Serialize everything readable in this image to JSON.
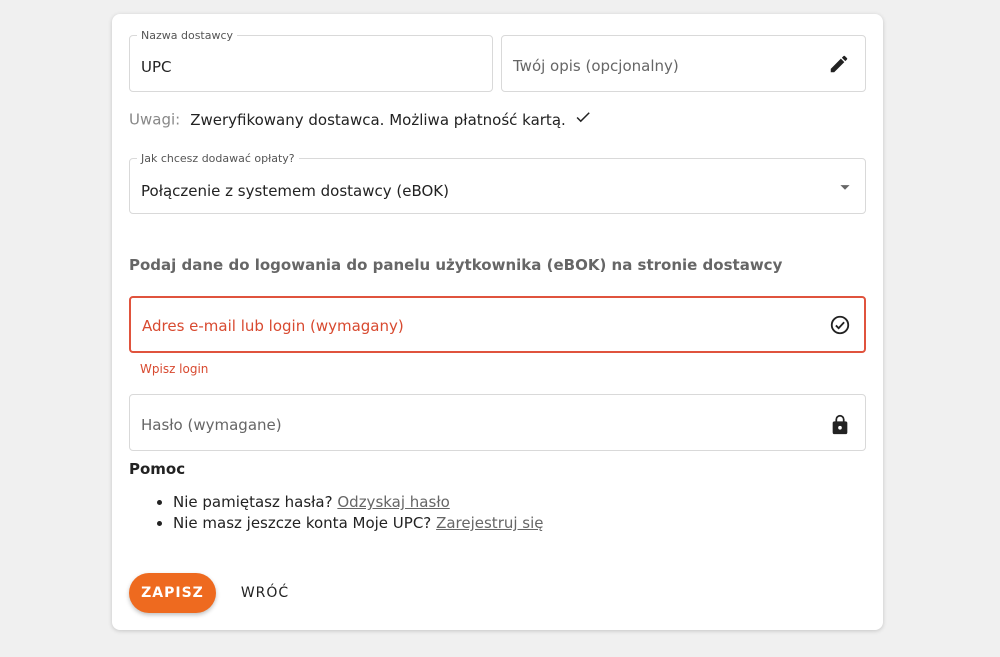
{
  "form": {
    "provider_name": {
      "label": "Nazwa dostawcy",
      "value": "UPC"
    },
    "description": {
      "placeholder": "Twój opis (opcjonalny)",
      "icon": "pencil-icon"
    },
    "notes": {
      "label": "Uwagi:",
      "text": "Zweryfikowany dostawca. Możliwa płatność kartą.",
      "icon": "check-icon"
    },
    "fees_method": {
      "label": "Jak chcesz dodawać opłaty?",
      "value": "Połączenie z systemem dostawcy (eBOK)",
      "icon": "caret-down-icon"
    },
    "section_title": "Podaj dane do logowania do panelu użytkownika (eBOK) na stronie dostawcy",
    "login": {
      "placeholder": "Adres e-mail lub login (wymagany)",
      "error": "Wpisz login",
      "icon": "check-circle-icon"
    },
    "password": {
      "placeholder": "Hasło (wymagane)",
      "icon": "lock-icon"
    },
    "help": {
      "title": "Pomoc",
      "items": [
        {
          "text": "Nie pamiętasz hasła?",
          "link": "Odzyskaj hasło"
        },
        {
          "text": "Nie masz jeszcze konta Moje UPC?",
          "link": "Zarejestruj się"
        }
      ]
    },
    "actions": {
      "save": "ZAPISZ",
      "back": "WRÓĆ"
    }
  },
  "colors": {
    "accent": "#ee6a1f",
    "error": "#d84a30",
    "background": "#f0f0f0"
  }
}
